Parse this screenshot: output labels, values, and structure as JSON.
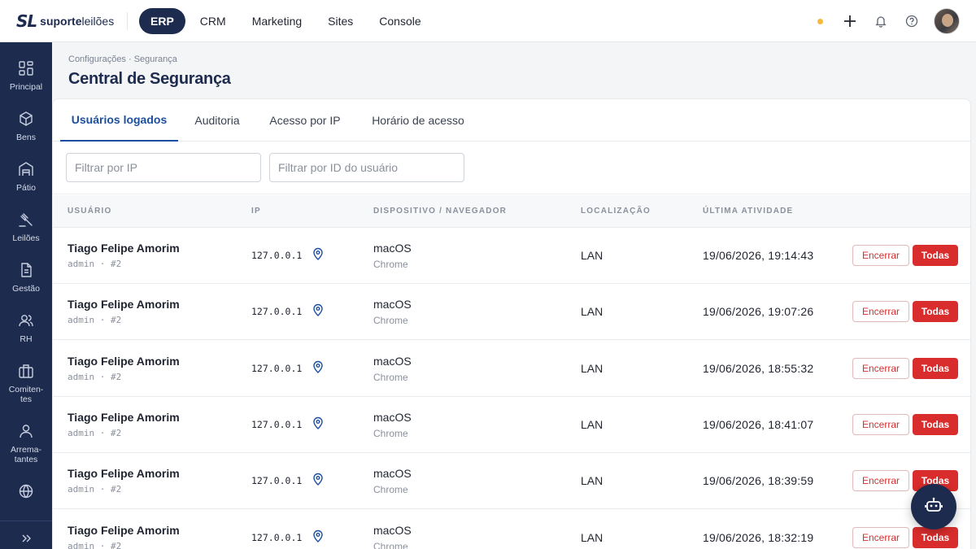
{
  "brand": {
    "mark": "SL",
    "name_bold": "suporte",
    "name_light": "leilões"
  },
  "topnav": [
    {
      "label": "ERP",
      "active": true
    },
    {
      "label": "CRM"
    },
    {
      "label": "Marketing"
    },
    {
      "label": "Sites"
    },
    {
      "label": "Console"
    }
  ],
  "sidebar": [
    {
      "label": "Principal",
      "icon": "grid-icon"
    },
    {
      "label": "Bens",
      "icon": "box-icon"
    },
    {
      "label": "Pátio",
      "icon": "warehouse-icon"
    },
    {
      "label": "Leilões",
      "icon": "gavel-icon"
    },
    {
      "label": "Gestão",
      "icon": "document-icon"
    },
    {
      "label": "RH",
      "icon": "users-icon"
    },
    {
      "label": "Comiten-\ntes",
      "icon": "briefcase-icon"
    },
    {
      "label": "Arrema-\ntantes",
      "icon": "user-icon"
    },
    {
      "label": "",
      "icon": "globe-icon"
    },
    {
      "label": "",
      "icon": "expand-icon"
    }
  ],
  "breadcrumb": "Configurações · Segurança",
  "page_title": "Central de Segurança",
  "tabs": [
    {
      "label": "Usuários logados",
      "active": true
    },
    {
      "label": "Auditoria"
    },
    {
      "label": "Acesso por IP"
    },
    {
      "label": "Horário de acesso"
    }
  ],
  "filters": {
    "ip_placeholder": "Filtrar por IP",
    "user_placeholder": "Filtrar por ID do usuário"
  },
  "table": {
    "headers": [
      "USUÁRIO",
      "IP",
      "DISPOSITIVO / NAVEGADOR",
      "LOCALIZAÇÃO",
      "ÚLTIMA ATIVIDADE"
    ],
    "end_label": "Encerrar",
    "all_label": "Todas",
    "rows": [
      {
        "name": "Tiago Felipe Amorim",
        "role": "admin · #2",
        "ip": "127.0.0.1",
        "os": "macOS",
        "browser": "Chrome",
        "location": "LAN",
        "last": "19/06/2026, 19:14:43"
      },
      {
        "name": "Tiago Felipe Amorim",
        "role": "admin · #2",
        "ip": "127.0.0.1",
        "os": "macOS",
        "browser": "Chrome",
        "location": "LAN",
        "last": "19/06/2026, 19:07:26"
      },
      {
        "name": "Tiago Felipe Amorim",
        "role": "admin · #2",
        "ip": "127.0.0.1",
        "os": "macOS",
        "browser": "Chrome",
        "location": "LAN",
        "last": "19/06/2026, 18:55:32"
      },
      {
        "name": "Tiago Felipe Amorim",
        "role": "admin · #2",
        "ip": "127.0.0.1",
        "os": "macOS",
        "browser": "Chrome",
        "location": "LAN",
        "last": "19/06/2026, 18:41:07"
      },
      {
        "name": "Tiago Felipe Amorim",
        "role": "admin · #2",
        "ip": "127.0.0.1",
        "os": "macOS",
        "browser": "Chrome",
        "location": "LAN",
        "last": "19/06/2026, 18:39:59"
      },
      {
        "name": "Tiago Felipe Amorim",
        "role": "admin · #2",
        "ip": "127.0.0.1",
        "os": "macOS",
        "browser": "Chrome",
        "location": "LAN",
        "last": "19/06/2026, 18:32:19"
      }
    ]
  },
  "colors": {
    "navy": "#1d2b4f",
    "accent_blue": "#1d4fa0",
    "danger": "#d92d2d",
    "status_dot": "#f6b93b"
  }
}
